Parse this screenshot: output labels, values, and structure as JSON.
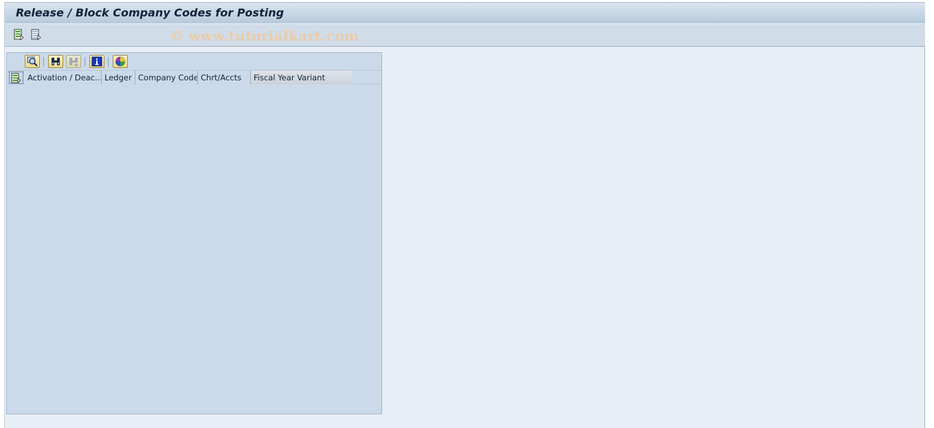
{
  "window": {
    "title": "Release / Block Company Codes for Posting"
  },
  "app_toolbar": {
    "buttons": [
      {
        "name": "select-layout-button",
        "icon": "list-green-arrow-icon"
      },
      {
        "name": "detail-view-button",
        "icon": "list-arrow-icon"
      }
    ],
    "watermark": "© www.tutorialkart.com"
  },
  "alv_grid": {
    "toolbar": [
      {
        "name": "details-button",
        "icon": "magnifier-icon"
      },
      {
        "name": "find-button",
        "icon": "binoculars-icon"
      },
      {
        "name": "find-next-button",
        "icon": "binoculars-plus-icon",
        "disabled": true
      },
      {
        "name": "info-button",
        "icon": "info-icon"
      },
      {
        "name": "color-legend-button",
        "icon": "color-wheel-icon"
      }
    ],
    "columns": [
      {
        "label": "Activation / Deac..."
      },
      {
        "label": "Ledger"
      },
      {
        "label": "Company Code"
      },
      {
        "label": "Chrt/Accts"
      },
      {
        "label": "Fiscal Year Variant"
      }
    ],
    "rows": []
  },
  "colors": {
    "title_text": "#10243a",
    "window_bg": "#e8eef5",
    "grid_bg": "#cadaea",
    "watermark": "#f0c8a0"
  }
}
